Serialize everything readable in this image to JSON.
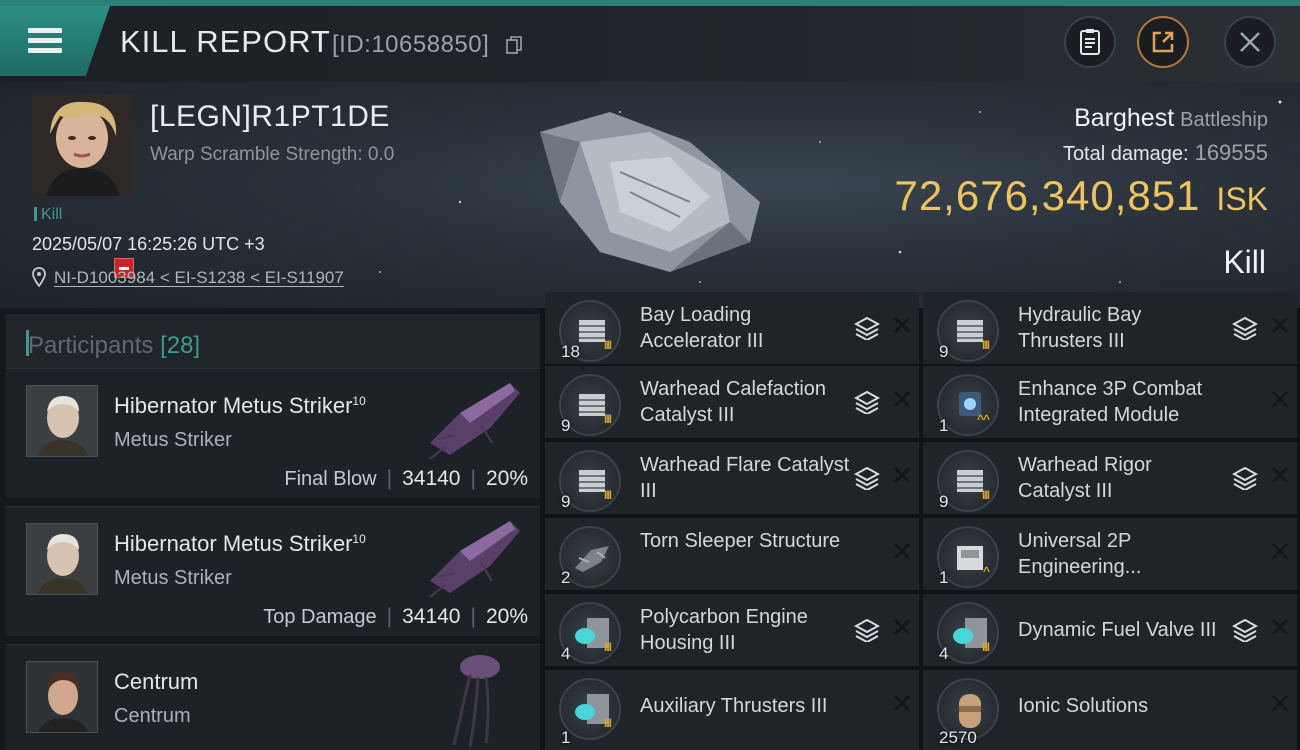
{
  "topbar": {
    "title": "KILL REPORT",
    "report_id": "[ID:10658850]"
  },
  "victim": {
    "name": "[LEGN]R1PT1DE",
    "warp_scramble": "Warp Scramble Strength: 0.0",
    "tag": "Kill",
    "datetime": "2025/05/07 16:25:26 UTC +3",
    "location": "NI-D1003984 < EI-S1238 < EI-S11907",
    "ship_name": "Barghest",
    "ship_class": "Battleship",
    "damage_label": "Total damage:",
    "damage_value": "169555",
    "isk_value": "72,676,340,851",
    "isk_unit": "ISK",
    "result": "Kill"
  },
  "participants": {
    "label": "Participants",
    "count": "[28]",
    "rows": [
      {
        "name": "Hibernator Metus Striker",
        "level": "10",
        "ship": "Metus Striker",
        "stat_label": "Final Blow",
        "damage": "34140",
        "percent": "20%"
      },
      {
        "name": "Hibernator Metus Striker",
        "level": "10",
        "ship": "Metus Striker",
        "stat_label": "Top Damage",
        "damage": "34140",
        "percent": "20%"
      },
      {
        "name": "Centrum",
        "level": "",
        "ship": "Centrum",
        "stat_label": "",
        "damage": "",
        "percent": ""
      }
    ]
  },
  "items": [
    {
      "name": "Bay Loading Accelerator III",
      "qty": "18"
    },
    {
      "name": "Hydraulic Bay Thrusters III",
      "qty": "9"
    },
    {
      "name": "Warhead Calefaction Catalyst III",
      "qty": "9"
    },
    {
      "name": "Enhance 3P Combat Integrated Module",
      "qty": "1"
    },
    {
      "name": "Warhead Flare Catalyst III",
      "qty": "9"
    },
    {
      "name": "Warhead Rigor Catalyst III",
      "qty": "9"
    },
    {
      "name": "Torn Sleeper Structure",
      "qty": "2"
    },
    {
      "name": "Universal 2P Engineering...",
      "qty": "1"
    },
    {
      "name": "Polycarbon Engine Housing III",
      "qty": "4"
    },
    {
      "name": "Dynamic Fuel Valve III",
      "qty": "4"
    },
    {
      "name": "Auxiliary Thrusters III",
      "qty": "1"
    },
    {
      "name": "Ionic Solutions",
      "qty": "2570"
    }
  ],
  "colors": {
    "accent": "#2a7f79",
    "isk": "#efc45f",
    "badge": "#c5262a"
  }
}
